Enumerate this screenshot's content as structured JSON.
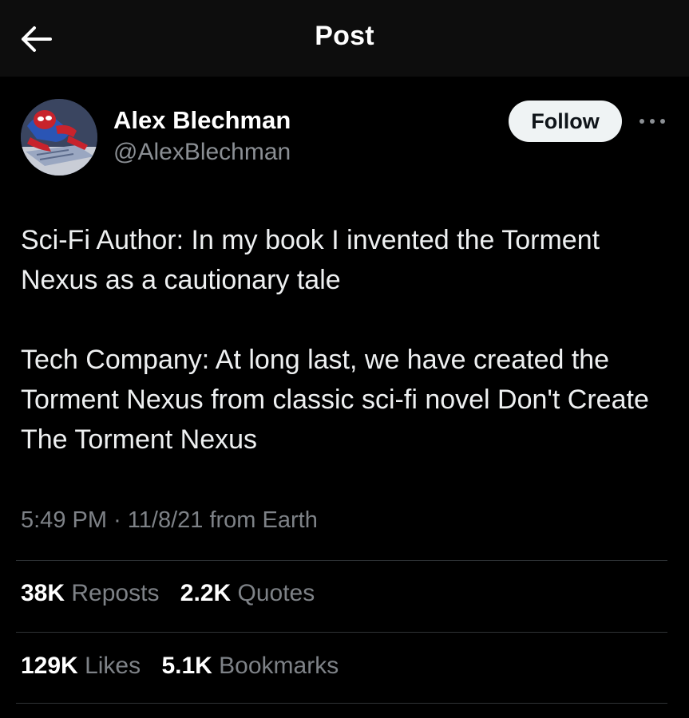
{
  "header": {
    "title": "Post",
    "back_icon": "arrow-left-icon"
  },
  "author": {
    "name": "Alex Blechman",
    "handle": "@AlexBlechman",
    "avatar_icon": "spiderman-avatar"
  },
  "actions": {
    "follow_label": "Follow",
    "more_icon": "more-horizontal-icon"
  },
  "tweet": {
    "paragraph1": "Sci-Fi Author: In my book I invented the Torment Nexus as a cautionary tale",
    "paragraph2": "Tech Company: At long last, we have created the Torment Nexus from classic sci-fi novel Don't Create The Torment Nexus"
  },
  "meta": {
    "time": "5:49 PM",
    "separator": "·",
    "date": "11/8/21",
    "location": "from Earth"
  },
  "stats": {
    "reposts": {
      "count": "38K",
      "label": "Reposts"
    },
    "quotes": {
      "count": "2.2K",
      "label": "Quotes"
    },
    "likes": {
      "count": "129K",
      "label": "Likes"
    },
    "bookmarks": {
      "count": "5.1K",
      "label": "Bookmarks"
    }
  },
  "colors": {
    "background": "#000000",
    "header_background": "#0d0d0d",
    "text_primary": "#e7e9ea",
    "text_secondary": "#7e8287",
    "follow_button_bg": "#eff3f4",
    "divider": "#2f3336"
  }
}
